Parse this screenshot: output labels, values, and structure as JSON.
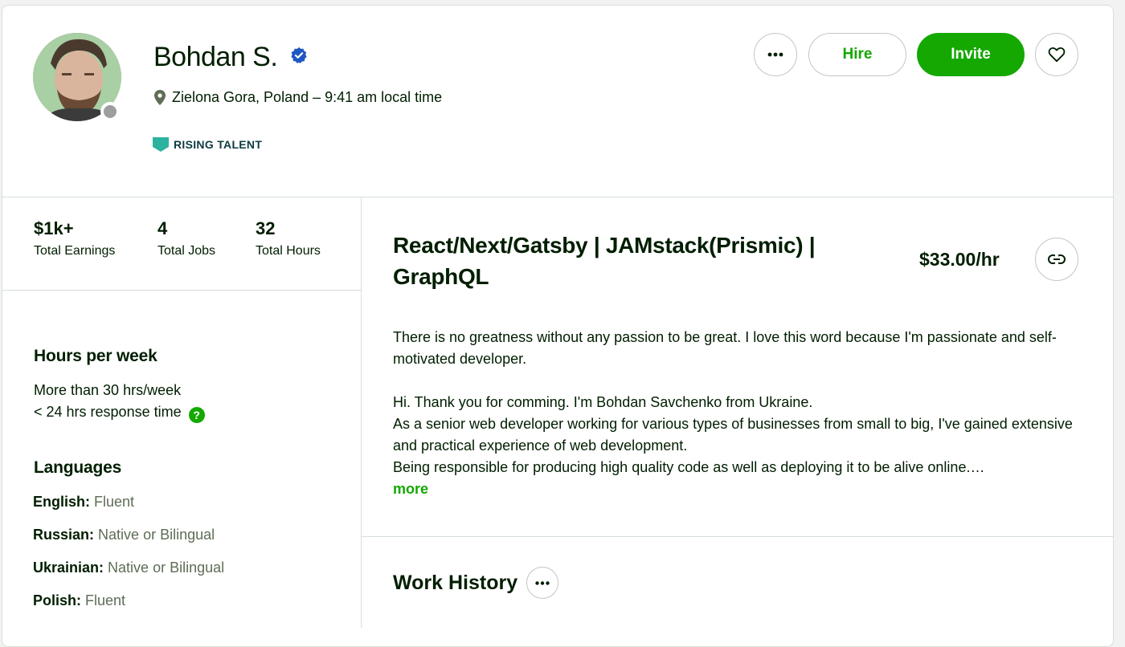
{
  "profile": {
    "name": "Bohdan S.",
    "location": "Zielona Gora, Poland – 9:41 am local time",
    "badge": "RISING TALENT"
  },
  "actions": {
    "hire": "Hire",
    "invite": "Invite",
    "more_icon": "ellipsis-icon",
    "favorite_icon": "heart-icon"
  },
  "stats": [
    {
      "value": "$1k+",
      "label": "Total Earnings"
    },
    {
      "value": "4",
      "label": "Total Jobs"
    },
    {
      "value": "32",
      "label": "Total Hours"
    }
  ],
  "availability": {
    "heading": "Hours per week",
    "hours": "More than 30 hrs/week",
    "response": "< 24 hrs response time"
  },
  "languages": {
    "heading": "Languages",
    "items": [
      {
        "name": "English:",
        "level": "Fluent"
      },
      {
        "name": "Russian:",
        "level": "Native or Bilingual"
      },
      {
        "name": "Ukrainian:",
        "level": "Native or Bilingual"
      },
      {
        "name": "Polish:",
        "level": "Fluent"
      }
    ]
  },
  "headline": {
    "title": "React/Next/Gatsby | JAMstack(Prismic) | GraphQL",
    "rate": "$33.00/hr"
  },
  "description": {
    "p1": "There is no greatness without any passion to be great. I love this word because I'm passionate and self-motivated developer.",
    "p2a": "Hi. Thank you for comming. I'm Bohdan Savchenko from Ukraine.",
    "p2b": "As a senior web developer working for various types of businesses from small to big, I've gained extensive and practical experience of web development.",
    "p2c": "Being responsible for producing high quality code as well as deploying it to be alive online.…",
    "more": "more"
  },
  "work_history": {
    "heading": "Work History"
  },
  "colors": {
    "accent": "#14a800",
    "badge": "#2bb3a0",
    "verified": "#1f57c3"
  }
}
